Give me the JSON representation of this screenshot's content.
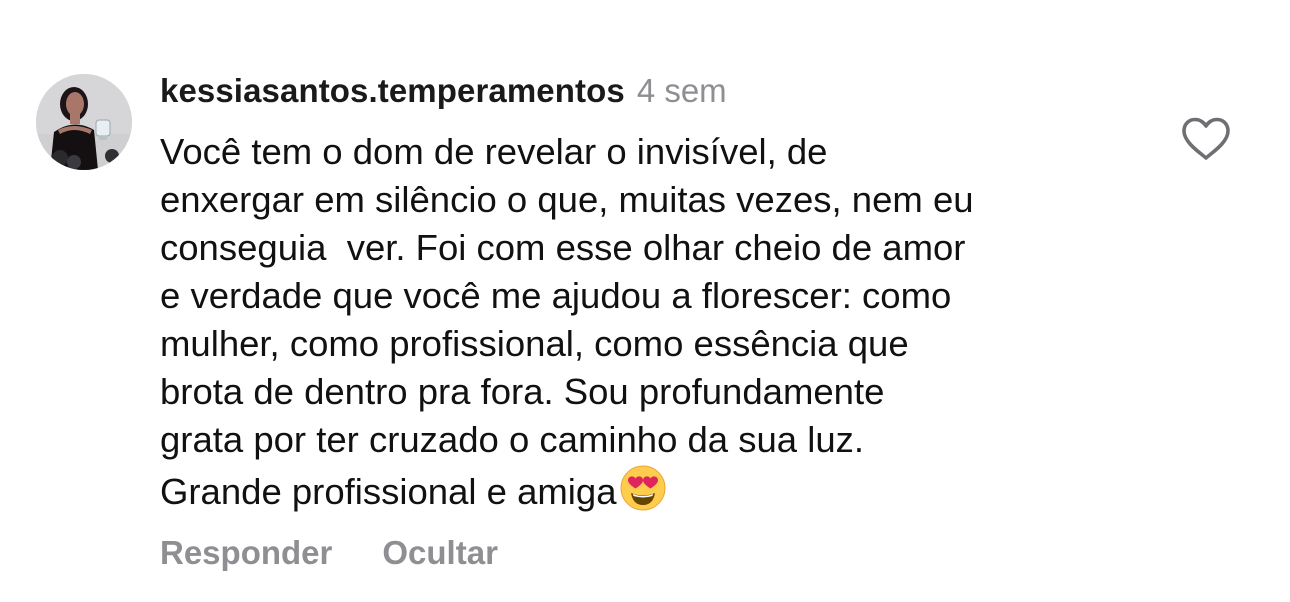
{
  "comment": {
    "username": "kessiasantos.temperamentos",
    "timestamp": "4 sem",
    "avatar_icon": "profile-photo",
    "lines": [
      "Você tem o dom de revelar o invisível, de",
      "enxergar em silêncio o que, muitas vezes, nem eu",
      "conseguia  ver. Foi com esse olhar cheio de amor",
      "e verdade que você me ajudou a florescer: como",
      "mulher, como profissional, como essência que",
      "brota de dentro pra fora. Sou profundamente",
      "grata por ter cruzado o caminho da sua luz.",
      "Grande profissional e amiga"
    ],
    "emoji": "😍",
    "like_icon": "heart-outline-icon"
  },
  "actions": {
    "reply_label": "Responder",
    "hide_label": "Ocultar"
  },
  "colors": {
    "text": "#111111",
    "muted": "#8e8e93",
    "background": "#ffffff"
  }
}
